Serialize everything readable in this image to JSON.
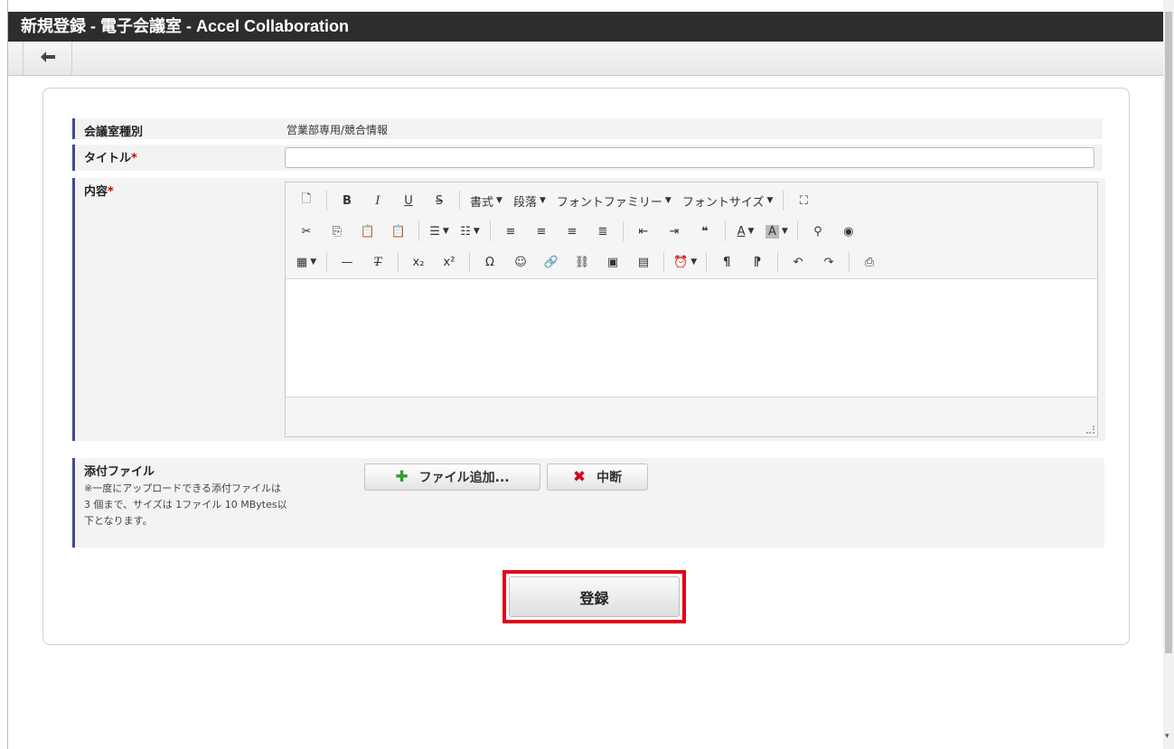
{
  "window": {
    "title": "新規登録 - 電子会議室 - Accel Collaboration"
  },
  "toolbar": {
    "back_icon": "arrow-left-icon"
  },
  "form": {
    "room_type": {
      "label": "会議室種別",
      "value": "営業部専用/競合情報"
    },
    "title": {
      "label": "タイトル",
      "required_mark": "*",
      "value": "",
      "placeholder": ""
    },
    "content": {
      "label": "内容",
      "required_mark": "*",
      "editor": {
        "row1": [
          {
            "type": "icon",
            "name": "new-document-icon",
            "glyph": "🗋"
          },
          {
            "type": "sep"
          },
          {
            "type": "icon",
            "name": "bold-icon",
            "glyph": "B"
          },
          {
            "type": "icon",
            "name": "italic-icon",
            "glyph": "I"
          },
          {
            "type": "icon",
            "name": "underline-icon",
            "glyph": "U"
          },
          {
            "type": "icon",
            "name": "strikethrough-icon",
            "glyph": "S"
          },
          {
            "type": "sep"
          },
          {
            "type": "combo",
            "name": "format-dropdown",
            "label": "書式"
          },
          {
            "type": "combo",
            "name": "paragraph-dropdown",
            "label": "段落"
          },
          {
            "type": "combo",
            "name": "font-family-dropdown",
            "label": "フォントファミリー"
          },
          {
            "type": "combo",
            "name": "font-size-dropdown",
            "label": "フォントサイズ"
          },
          {
            "type": "sep"
          },
          {
            "type": "icon",
            "name": "fullscreen-icon",
            "glyph": "⛶"
          }
        ],
        "row2": [
          {
            "type": "icon",
            "name": "cut-icon",
            "glyph": "✂"
          },
          {
            "type": "icon",
            "name": "copy-icon",
            "glyph": "⎘"
          },
          {
            "type": "icon",
            "name": "paste-icon",
            "glyph": "📋"
          },
          {
            "type": "icon",
            "name": "paste-text-icon",
            "glyph": "📋"
          },
          {
            "type": "sep"
          },
          {
            "type": "icon",
            "name": "bullet-list-icon",
            "glyph": "☰",
            "caret": true
          },
          {
            "type": "icon",
            "name": "numbered-list-icon",
            "glyph": "☷",
            "caret": true
          },
          {
            "type": "sep"
          },
          {
            "type": "icon",
            "name": "align-left-icon",
            "glyph": "≡"
          },
          {
            "type": "icon",
            "name": "align-center-icon",
            "glyph": "≡"
          },
          {
            "type": "icon",
            "name": "align-right-icon",
            "glyph": "≡"
          },
          {
            "type": "icon",
            "name": "align-justify-icon",
            "glyph": "≣"
          },
          {
            "type": "sep"
          },
          {
            "type": "icon",
            "name": "outdent-icon",
            "glyph": "⇤"
          },
          {
            "type": "icon",
            "name": "indent-icon",
            "glyph": "⇥"
          },
          {
            "type": "icon",
            "name": "blockquote-icon",
            "glyph": "❝"
          },
          {
            "type": "sep"
          },
          {
            "type": "icon",
            "name": "text-color-icon",
            "glyph": "A",
            "caret": true
          },
          {
            "type": "icon",
            "name": "background-color-icon",
            "glyph": "A",
            "caret": true
          },
          {
            "type": "sep"
          },
          {
            "type": "icon",
            "name": "find-replace-icon",
            "glyph": "⚲"
          },
          {
            "type": "icon",
            "name": "preview-icon",
            "glyph": "◉"
          }
        ],
        "row3": [
          {
            "type": "icon",
            "name": "table-icon",
            "glyph": "▦",
            "caret": true
          },
          {
            "type": "sep"
          },
          {
            "type": "icon",
            "name": "horizontal-rule-icon",
            "glyph": "—"
          },
          {
            "type": "icon",
            "name": "clear-formatting-icon",
            "glyph": "T"
          },
          {
            "type": "sep"
          },
          {
            "type": "icon",
            "name": "subscript-icon",
            "glyph": "x₂"
          },
          {
            "type": "icon",
            "name": "superscript-icon",
            "glyph": "x²"
          },
          {
            "type": "sep"
          },
          {
            "type": "icon",
            "name": "special-character-icon",
            "glyph": "Ω"
          },
          {
            "type": "icon",
            "name": "emoticon-icon",
            "glyph": "☺"
          },
          {
            "type": "icon",
            "name": "link-icon",
            "glyph": "🔗"
          },
          {
            "type": "icon",
            "name": "unlink-icon",
            "glyph": "⛓"
          },
          {
            "type": "icon",
            "name": "image-icon",
            "glyph": "▣"
          },
          {
            "type": "icon",
            "name": "media-icon",
            "glyph": "▤"
          },
          {
            "type": "sep"
          },
          {
            "type": "icon",
            "name": "insert-datetime-icon",
            "glyph": "⏰",
            "caret": true
          },
          {
            "type": "sep"
          },
          {
            "type": "icon",
            "name": "ltr-icon",
            "glyph": "¶"
          },
          {
            "type": "icon",
            "name": "rtl-icon",
            "glyph": "¶"
          },
          {
            "type": "sep"
          },
          {
            "type": "icon",
            "name": "undo-icon",
            "glyph": "↶"
          },
          {
            "type": "icon",
            "name": "redo-icon",
            "glyph": "↷"
          },
          {
            "type": "sep"
          },
          {
            "type": "icon",
            "name": "print-icon",
            "glyph": "⎙"
          }
        ]
      }
    },
    "attachment": {
      "label": "添付ファイル",
      "note_line1": "※一度にアップロードできる添付ファイルは",
      "note_line2": "3 個まで、サイズは 1ファイル 10 MBytes以",
      "note_line3": "下となります。",
      "add_button": "ファイル追加...",
      "cancel_button": "中断"
    },
    "submit_button": "登録"
  },
  "colors": {
    "titlebar": "#2d2d2d",
    "label_accent": "#3b4a9c",
    "add_icon": "#2e9e2e",
    "cancel_icon": "#d0021b",
    "highlight_box": "#e2001a"
  }
}
